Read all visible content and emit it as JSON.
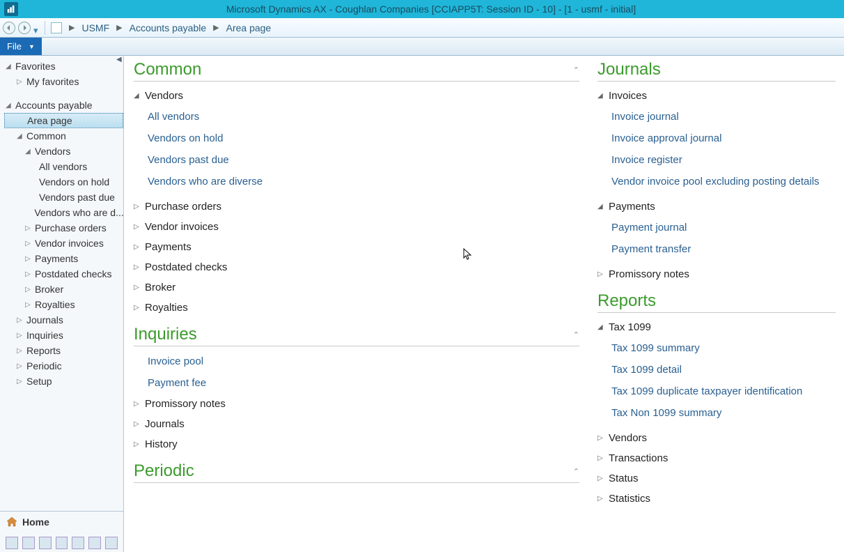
{
  "window": {
    "title": "Microsoft Dynamics AX - Coughlan Companies [CCIAPP5T: Session ID - 10]  -  [1 - usmf - initial]"
  },
  "breadcrumb": {
    "items": [
      "USMF",
      "Accounts payable",
      "Area page"
    ]
  },
  "ribbon": {
    "file": "File"
  },
  "sidebar": {
    "favorites": "Favorites",
    "my_favorites": "My favorites",
    "accounts_payable": "Accounts payable",
    "area_page": "Area page",
    "common": "Common",
    "vendors": "Vendors",
    "all_vendors": "All vendors",
    "vendors_on_hold": "Vendors on hold",
    "vendors_past_due": "Vendors past due",
    "vendors_diverse": "Vendors who are d...",
    "purchase_orders": "Purchase orders",
    "vendor_invoices": "Vendor invoices",
    "payments": "Payments",
    "postdated_checks": "Postdated checks",
    "broker": "Broker",
    "royalties": "Royalties",
    "journals": "Journals",
    "inquiries": "Inquiries",
    "reports": "Reports",
    "periodic": "Periodic",
    "setup": "Setup",
    "home": "Home"
  },
  "content": {
    "common": {
      "title": "Common",
      "vendors": {
        "label": "Vendors",
        "links": [
          "All vendors",
          "Vendors on hold",
          "Vendors past due",
          "Vendors who are diverse"
        ]
      },
      "purchase_orders": "Purchase orders",
      "vendor_invoices": "Vendor invoices",
      "payments": "Payments",
      "postdated_checks": "Postdated checks",
      "broker": "Broker",
      "royalties": "Royalties"
    },
    "inquiries": {
      "title": "Inquiries",
      "invoice_pool": "Invoice pool",
      "payment_fee": "Payment fee",
      "promissory_notes": "Promissory notes",
      "journals": "Journals",
      "history": "History"
    },
    "periodic": {
      "title": "Periodic"
    },
    "journals": {
      "title": "Journals",
      "invoices": {
        "label": "Invoices",
        "links": [
          "Invoice journal",
          "Invoice approval journal",
          "Invoice register",
          "Vendor invoice pool excluding posting details"
        ]
      },
      "payments_group": {
        "label": "Payments",
        "links": [
          "Payment journal",
          "Payment transfer"
        ]
      },
      "promissory_notes": "Promissory notes"
    },
    "reports": {
      "title": "Reports",
      "tax1099": {
        "label": "Tax 1099",
        "links": [
          "Tax 1099 summary",
          "Tax 1099 detail",
          "Tax 1099 duplicate taxpayer identification",
          "Tax Non 1099 summary"
        ]
      },
      "vendors": "Vendors",
      "transactions": "Transactions",
      "status": "Status",
      "statistics": "Statistics"
    }
  }
}
